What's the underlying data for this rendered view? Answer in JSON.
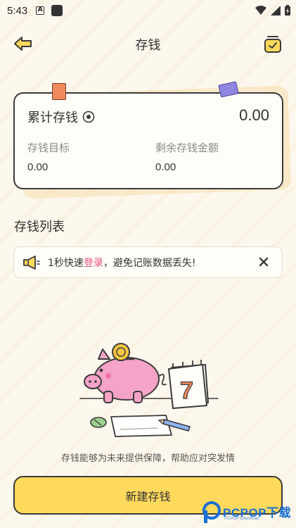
{
  "status_bar": {
    "time": "5:43",
    "a_badge": "A"
  },
  "header": {
    "title": "存钱",
    "back_icon": "arrow-left-icon",
    "right_icon": "calendar-check-icon"
  },
  "summary": {
    "total_label": "累计存钱",
    "total_value": "0.00",
    "goal_label": "存钱目标",
    "goal_value": "0.00",
    "remaining_label": "剩余存钱金额",
    "remaining_value": "0.00"
  },
  "section": {
    "title": "存钱列表"
  },
  "login_banner": {
    "prefix": "1秒快速",
    "link": "登录",
    "suffix": "，避免记账数据丢失!"
  },
  "empty_state": {
    "calendar_number": "7",
    "message": "存钱能够为未来提供保障，帮助应对突发情"
  },
  "new_button": {
    "label": "新建存钱"
  },
  "watermark": {
    "brand": "PCPOP下载",
    "sub": "PCPOP Download"
  },
  "colors": {
    "background": "#fdf8ee",
    "accent_yellow": "#ffd95c",
    "link_pink": "#e0507a",
    "pig_pink": "#f6a3c8",
    "coin_gold": "#f5c542"
  }
}
